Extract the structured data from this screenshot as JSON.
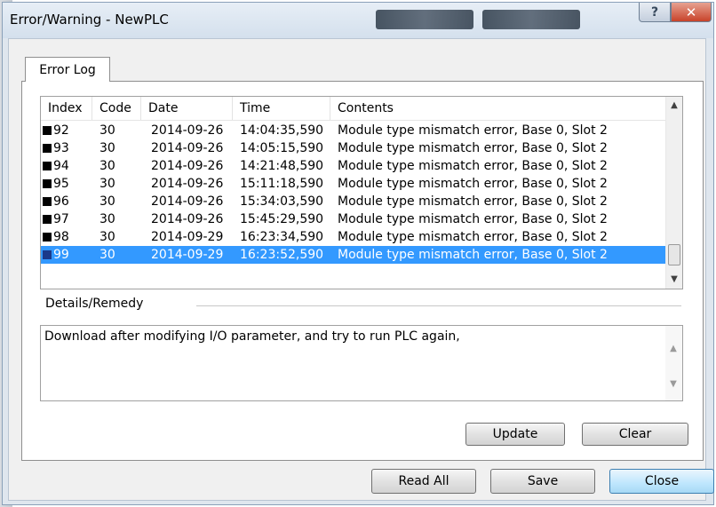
{
  "window": {
    "title": "Error/Warning - NewPLC"
  },
  "titlebar": {
    "help_label": "?",
    "close_label": "✕"
  },
  "tabs": [
    {
      "label": "Error Log"
    }
  ],
  "error_list": {
    "columns": [
      "Index",
      "Code",
      "Date",
      "Time",
      "Contents"
    ],
    "rows": [
      {
        "index": "92",
        "code": "30",
        "date": "2014-09-26",
        "time": "14:04:35,590",
        "contents": "Module type mismatch error, Base 0, Slot 2"
      },
      {
        "index": "93",
        "code": "30",
        "date": "2014-09-26",
        "time": "14:05:15,590",
        "contents": "Module type mismatch error, Base 0, Slot 2"
      },
      {
        "index": "94",
        "code": "30",
        "date": "2014-09-26",
        "time": "14:21:48,590",
        "contents": "Module type mismatch error, Base 0, Slot 2"
      },
      {
        "index": "95",
        "code": "30",
        "date": "2014-09-26",
        "time": "15:11:18,590",
        "contents": "Module type mismatch error, Base 0, Slot 2"
      },
      {
        "index": "96",
        "code": "30",
        "date": "2014-09-26",
        "time": "15:34:03,590",
        "contents": "Module type mismatch error, Base 0, Slot 2"
      },
      {
        "index": "97",
        "code": "30",
        "date": "2014-09-26",
        "time": "15:45:29,590",
        "contents": "Module type mismatch error, Base 0, Slot 2"
      },
      {
        "index": "98",
        "code": "30",
        "date": "2014-09-29",
        "time": "16:23:34,590",
        "contents": "Module type mismatch error, Base 0, Slot 2"
      },
      {
        "index": "99",
        "code": "30",
        "date": "2014-09-29",
        "time": "16:23:52,590",
        "contents": "Module type mismatch error, Base 0, Slot 2",
        "selected": true
      }
    ]
  },
  "details": {
    "group_label": "Details/Remedy",
    "text": "Download after modifying I/O parameter, and try to run PLC again,"
  },
  "buttons": {
    "update": "Update",
    "clear": "Clear",
    "read_all": "Read All",
    "save": "Save",
    "close": "Close"
  },
  "icons": {
    "scroll_up": "scroll-up-arrow-icon",
    "scroll_down": "scroll-down-arrow-icon",
    "row_marker": "black-square-icon"
  },
  "colors": {
    "selection": "#3399ff",
    "title_close": "#c8432a"
  }
}
